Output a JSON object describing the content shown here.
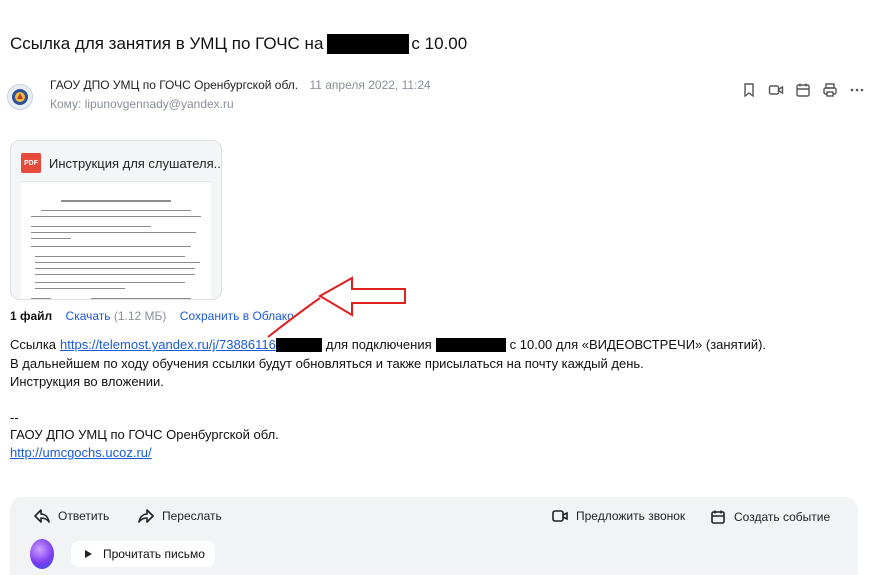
{
  "email": {
    "subject_start": "Ссылка для занятия в УМЦ по ГОЧС на",
    "subject_end": "с 10.00",
    "sender": "ГАОУ ДПО УМЦ по ГОЧС Оренбургской обл.",
    "date": "11 апреля 2022, 11:24",
    "to": "Кому: lipunovgennady@yandex.ru"
  },
  "icons": {
    "toolbar": [
      "bookmark-icon",
      "video-icon",
      "calendar-icon",
      "print-icon",
      "more-icon"
    ]
  },
  "attachment": {
    "name": "Инструкция для слушателя...",
    "type": "PDF"
  },
  "files": {
    "count": "1 файл",
    "download": "Скачать",
    "size": "(1.12 МБ)",
    "save": "Сохранить в Облако"
  },
  "body": {
    "link_prefix": "Ссылка",
    "link": "https://telemost.yandex.ru/j/73886116",
    "link_suffix1": "для подключения",
    "link_suffix2": "с 10.00 для «ВИДЕОВСТРЕЧИ» (занятий).",
    "line2": "В дальнейшем по ходу обучения ссылки будут обновляться и также присылаться на почту каждый день.",
    "line3": "Инструкция во вложении.",
    "sig_dash": "--",
    "sig_org": "ГАОУ ДПО УМЦ по ГОЧС Оренбургской обл.",
    "sig_url": "http://umcgochs.ucoz.ru/"
  },
  "bottom": {
    "reply": "Ответить",
    "forward": "Переслать",
    "call": "Предложить звонок",
    "event": "Создать событие",
    "read": "Прочитать письмо"
  }
}
